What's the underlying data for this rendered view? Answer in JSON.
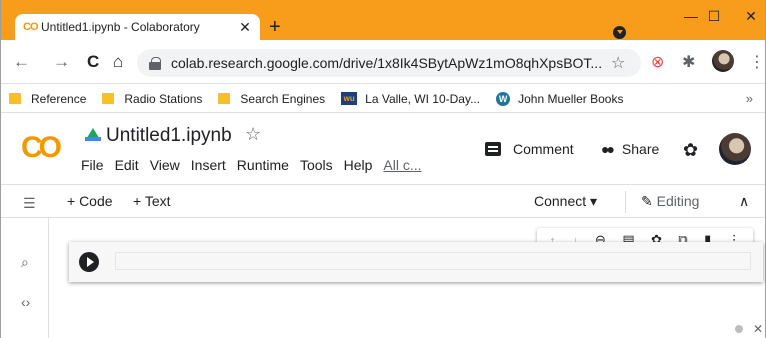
{
  "colors": {
    "tab_bar": "#f79c1b",
    "colab_orange": "#f29900"
  },
  "browser": {
    "tab": {
      "favicon": "CO",
      "title": "Untitled1.ipynb - Colaboratory",
      "close": "✕"
    },
    "new_tab": "+",
    "window": {
      "minimize": "—",
      "maximize": "☐",
      "close": "✕"
    },
    "nav": {
      "back": "←",
      "forward": "→",
      "reload": "C",
      "home": "⌂"
    },
    "url": "colab.research.google.com/drive/1x8Ik4SBytApWz1mO8qhXpsBOT...",
    "bookmark_star": "☆",
    "menu": "⋮",
    "bookmarks": [
      {
        "label": "Reference",
        "icon": "folder-icon"
      },
      {
        "label": "Radio Stations",
        "icon": "folder-icon"
      },
      {
        "label": "Search Engines",
        "icon": "folder-icon"
      },
      {
        "label": "La Valle, WI 10-Day...",
        "icon": "weather-underground-icon"
      },
      {
        "label": "John Mueller Books",
        "icon": "wordpress-icon"
      }
    ],
    "bookmarks_more": "»"
  },
  "colab": {
    "logo": "CO",
    "notebook_title": "Untitled1.ipynb",
    "star": "☆",
    "menu": [
      "File",
      "Edit",
      "View",
      "Insert",
      "Runtime",
      "Tools",
      "Help"
    ],
    "all_changes": "All c...",
    "comment_label": "Comment",
    "share_label": "Share",
    "toolbar": {
      "add_code": "+ Code",
      "add_text": "+ Text",
      "connect": "Connect ▾",
      "editing": "Editing",
      "collapse": "∧"
    },
    "cell_toolbar": [
      "↑",
      "↓",
      "⊖",
      "▤",
      "✿",
      "⧉",
      "▮",
      "⋮"
    ]
  }
}
